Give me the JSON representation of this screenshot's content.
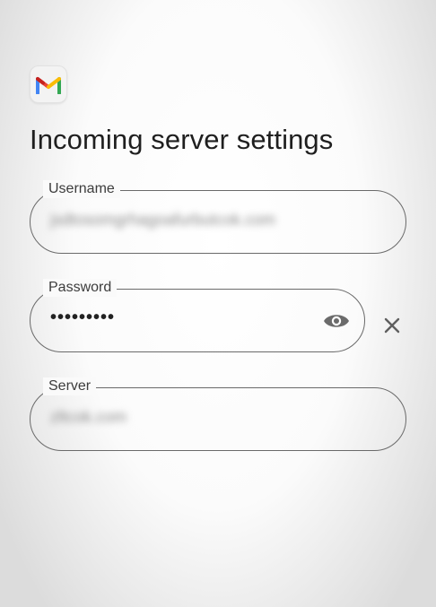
{
  "app": {
    "icon": "gmail-logo-icon"
  },
  "page": {
    "title": "Incoming server settings"
  },
  "fields": {
    "username": {
      "label": "Username",
      "value": "jsdtosomgrhagoafurbutcok.com"
    },
    "password": {
      "label": "Password",
      "value": "•••••••••",
      "toggle_icon": "eye-icon"
    },
    "server": {
      "label": "Server",
      "value": "zltcok.com"
    }
  },
  "actions": {
    "clear_icon": "close-icon"
  },
  "colors": {
    "outline": "#6a6a6a",
    "text": "#1f1f1f",
    "icon": "#6b6b6b"
  }
}
